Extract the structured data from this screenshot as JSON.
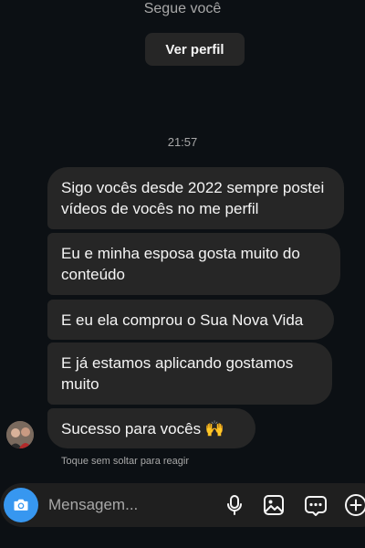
{
  "header": {
    "follows_text": "Segue você",
    "view_profile_label": "Ver perfil"
  },
  "thread": {
    "timestamp": "21:57",
    "messages": [
      {
        "text": "Sigo vocês desde 2022 sempre postei vídeos de vocês no me perfil"
      },
      {
        "text": "Eu e minha esposa gosta muito do conteúdo"
      },
      {
        "text": "E eu ela comprou o Sua Nova Vida"
      },
      {
        "text": "E já estamos aplicando gostamos muito"
      },
      {
        "text": "Sucesso para vocês 🙌"
      }
    ],
    "react_hint": "Toque sem soltar para reagir"
  },
  "composer": {
    "placeholder": "Mensagem...",
    "icons": [
      "camera-icon",
      "microphone-icon",
      "gallery-icon",
      "sticker-icon",
      "add-icon"
    ]
  },
  "colors": {
    "background": "#0c1014",
    "bubble": "#262626",
    "accent": "#3797f0",
    "muted_text": "#a8a8a8"
  }
}
